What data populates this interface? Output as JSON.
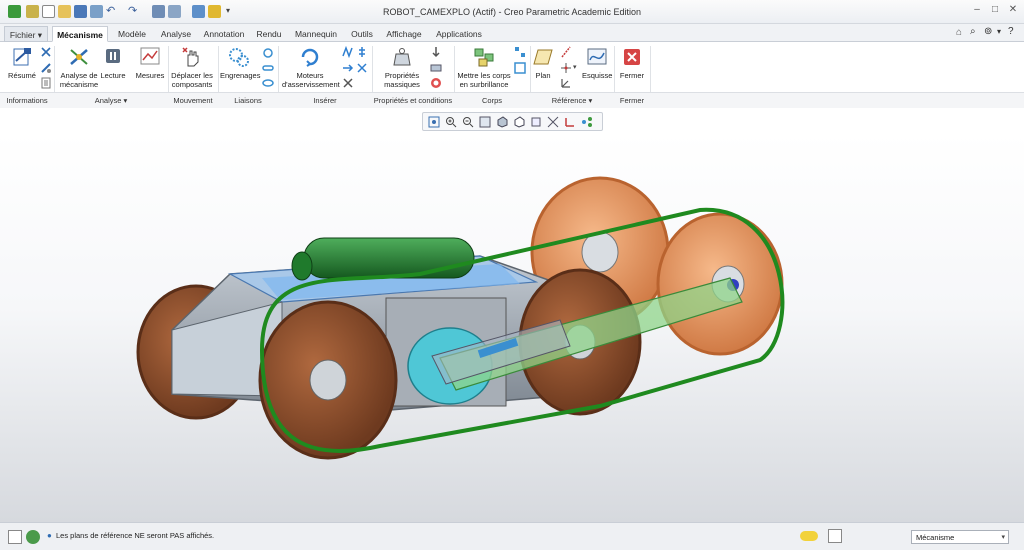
{
  "window": {
    "title": "ROBOT_CAMEXPLO (Actif) - Creo Parametric Academic Edition",
    "controls": [
      "–",
      "□",
      "✕"
    ]
  },
  "tabs": [
    {
      "label": "Fichier ▾",
      "active": false
    },
    {
      "label": "Mécanisme",
      "active": true
    },
    {
      "label": "Modèle",
      "active": false
    },
    {
      "label": "Analyse",
      "active": false
    },
    {
      "label": "Annotation",
      "active": false
    },
    {
      "label": "Rendu",
      "active": false
    },
    {
      "label": "Mannequin",
      "active": false
    },
    {
      "label": "Outils",
      "active": false
    },
    {
      "label": "Affichage",
      "active": false
    },
    {
      "label": "Applications",
      "active": false
    }
  ],
  "ribbon": {
    "resume": "Résumé",
    "analyse_l1": "Analyse de",
    "analyse_l2": "mécanisme",
    "lecture": "Lecture",
    "mesures": "Mesures",
    "deplacer_l1": "Déplacer les",
    "deplacer_l2": "composants",
    "engrenages": "Engrenages",
    "moteurs_l1": "Moteurs",
    "moteurs_l2": "d'asservissement",
    "proprietes_l1": "Propriétés",
    "proprietes_l2": "massiques",
    "surbrillance_l1": "Mettre les corps",
    "surbrillance_l2": "en surbrillance",
    "plan": "Plan",
    "esquisse": "Esquisse",
    "fermer": "Fermer"
  },
  "groups": {
    "informations": "Informations",
    "analyse": "Analyse ▾",
    "mouvement": "Mouvement",
    "liaisons": "Liaisons",
    "inserer": "Insérer",
    "proprietes": "Propriétés et conditions",
    "corps": "Corps",
    "reference": "Référence ▾",
    "fermer": "Fermer"
  },
  "status": {
    "message": "Les plans de référence NE seront PAS affichés.",
    "mode": "Mécanisme"
  },
  "colors": {
    "wheel": "#8a4b2a",
    "wheel_rear": "#e8935a",
    "track": "#1f8a1f",
    "tank": "#1e7a2c",
    "arm": "#8fd48a",
    "chassis": "#9aa3ad"
  }
}
